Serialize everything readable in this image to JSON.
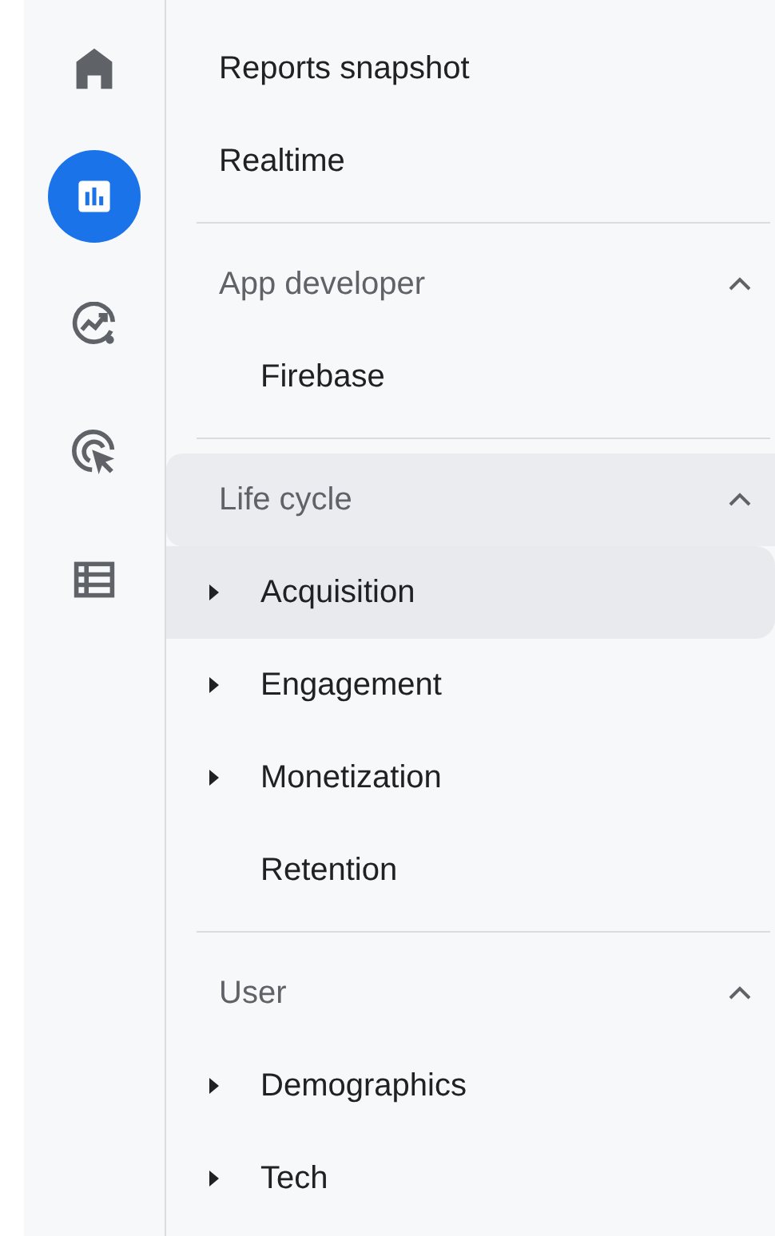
{
  "rail": [
    {
      "kind": "home",
      "selected": false
    },
    {
      "kind": "reports",
      "selected": true
    },
    {
      "kind": "explore",
      "selected": false
    },
    {
      "kind": "advertising",
      "selected": false
    },
    {
      "kind": "library",
      "selected": false
    }
  ],
  "top_items": [
    {
      "label": "Reports snapshot",
      "selected": false
    },
    {
      "label": "Realtime",
      "selected": false
    }
  ],
  "sections": [
    {
      "title": "App developer",
      "expanded": true,
      "hovered": false,
      "items": [
        {
          "label": "Firebase",
          "expandable": false,
          "selected": false
        }
      ]
    },
    {
      "title": "Life cycle",
      "expanded": true,
      "hovered": true,
      "items": [
        {
          "label": "Acquisition",
          "expandable": true,
          "selected": true
        },
        {
          "label": "Engagement",
          "expandable": true,
          "selected": false
        },
        {
          "label": "Monetization",
          "expandable": true,
          "selected": false
        },
        {
          "label": "Retention",
          "expandable": false,
          "selected": false
        }
      ]
    },
    {
      "title": "User",
      "expanded": true,
      "hovered": false,
      "items": [
        {
          "label": "Demographics",
          "expandable": true,
          "selected": false
        },
        {
          "label": "Tech",
          "expandable": true,
          "selected": false
        }
      ]
    }
  ]
}
